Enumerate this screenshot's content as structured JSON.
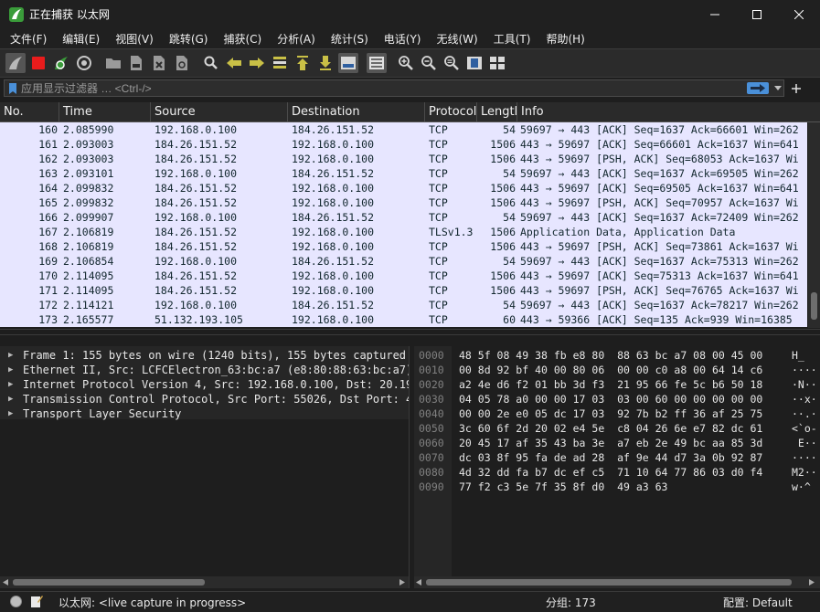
{
  "window": {
    "title": "正在捕获 以太网",
    "minimize_icon": "minimize-icon",
    "maximize_icon": "maximize-icon",
    "close_icon": "close-icon"
  },
  "menu": [
    "文件(F)",
    "编辑(E)",
    "视图(V)",
    "跳转(G)",
    "捕获(C)",
    "分析(A)",
    "统计(S)",
    "电话(Y)",
    "无线(W)",
    "工具(T)",
    "帮助(H)"
  ],
  "filter": {
    "placeholder": "应用显示过滤器 … <Ctrl-/>"
  },
  "packet_list": {
    "columns": [
      "No.",
      "Time",
      "Source",
      "Destination",
      "Protocol",
      "Length",
      "Info"
    ],
    "rows": [
      {
        "no": "160",
        "time": "2.085990",
        "src": "192.168.0.100",
        "dst": "184.26.151.52",
        "proto": "TCP",
        "len": "54",
        "info": "59697 → 443 [ACK] Seq=1637 Ack=66601 Win=262"
      },
      {
        "no": "161",
        "time": "2.093003",
        "src": "184.26.151.52",
        "dst": "192.168.0.100",
        "proto": "TCP",
        "len": "1506",
        "info": "443 → 59697 [ACK] Seq=66601 Ack=1637 Win=641"
      },
      {
        "no": "162",
        "time": "2.093003",
        "src": "184.26.151.52",
        "dst": "192.168.0.100",
        "proto": "TCP",
        "len": "1506",
        "info": "443 → 59697 [PSH, ACK] Seq=68053 Ack=1637 Wi"
      },
      {
        "no": "163",
        "time": "2.093101",
        "src": "192.168.0.100",
        "dst": "184.26.151.52",
        "proto": "TCP",
        "len": "54",
        "info": "59697 → 443 [ACK] Seq=1637 Ack=69505 Win=262"
      },
      {
        "no": "164",
        "time": "2.099832",
        "src": "184.26.151.52",
        "dst": "192.168.0.100",
        "proto": "TCP",
        "len": "1506",
        "info": "443 → 59697 [ACK] Seq=69505 Ack=1637 Win=641"
      },
      {
        "no": "165",
        "time": "2.099832",
        "src": "184.26.151.52",
        "dst": "192.168.0.100",
        "proto": "TCP",
        "len": "1506",
        "info": "443 → 59697 [PSH, ACK] Seq=70957 Ack=1637 Wi"
      },
      {
        "no": "166",
        "time": "2.099907",
        "src": "192.168.0.100",
        "dst": "184.26.151.52",
        "proto": "TCP",
        "len": "54",
        "info": "59697 → 443 [ACK] Seq=1637 Ack=72409 Win=262"
      },
      {
        "no": "167",
        "time": "2.106819",
        "src": "184.26.151.52",
        "dst": "192.168.0.100",
        "proto": "TLSv1.3",
        "len": "1506",
        "info": "Application Data, Application Data"
      },
      {
        "no": "168",
        "time": "2.106819",
        "src": "184.26.151.52",
        "dst": "192.168.0.100",
        "proto": "TCP",
        "len": "1506",
        "info": "443 → 59697 [PSH, ACK] Seq=73861 Ack=1637 Wi"
      },
      {
        "no": "169",
        "time": "2.106854",
        "src": "192.168.0.100",
        "dst": "184.26.151.52",
        "proto": "TCP",
        "len": "54",
        "info": "59697 → 443 [ACK] Seq=1637 Ack=75313 Win=262"
      },
      {
        "no": "170",
        "time": "2.114095",
        "src": "184.26.151.52",
        "dst": "192.168.0.100",
        "proto": "TCP",
        "len": "1506",
        "info": "443 → 59697 [ACK] Seq=75313 Ack=1637 Win=641"
      },
      {
        "no": "171",
        "time": "2.114095",
        "src": "184.26.151.52",
        "dst": "192.168.0.100",
        "proto": "TCP",
        "len": "1506",
        "info": "443 → 59697 [PSH, ACK] Seq=76765 Ack=1637 Wi"
      },
      {
        "no": "172",
        "time": "2.114121",
        "src": "192.168.0.100",
        "dst": "184.26.151.52",
        "proto": "TCP",
        "len": "54",
        "info": "59697 → 443 [ACK] Seq=1637 Ack=78217 Win=262"
      },
      {
        "no": "173",
        "time": "2.165577",
        "src": "51.132.193.105",
        "dst": "192.168.0.100",
        "proto": "TCP",
        "len": "60",
        "info": "443 → 59366 [ACK] Seq=135 Ack=939 Win=16385"
      }
    ]
  },
  "details": [
    "Frame 1: 155 bytes on wire (1240 bits), 155 bytes captured",
    "Ethernet II, Src: LCFCElectron_63:bc:a7 (e8:80:88:63:bc:a7)",
    "Internet Protocol Version 4, Src: 192.168.0.100, Dst: 20.19",
    "Transmission Control Protocol, Src Port: 55026, Dst Port: 4",
    "Transport Layer Security"
  ],
  "bytes": [
    {
      "off": "0000",
      "hex": "48 5f 08 49 38 fb e8 80  88 63 bc a7 08 00 45 00",
      "ascii": "H_"
    },
    {
      "off": "0010",
      "hex": "00 8d 92 bf 40 00 80 06  00 00 c0 a8 00 64 14 c6",
      "ascii": "····"
    },
    {
      "off": "0020",
      "hex": "a2 4e d6 f2 01 bb 3d f3  21 95 66 fe 5c b6 50 18",
      "ascii": "·N··"
    },
    {
      "off": "0030",
      "hex": "04 05 78 a0 00 00 17 03  03 00 60 00 00 00 00 00",
      "ascii": "··x·"
    },
    {
      "off": "0040",
      "hex": "00 00 2e e0 05 dc 17 03  92 7b b2 ff 36 af 25 75",
      "ascii": "··.·"
    },
    {
      "off": "0050",
      "hex": "3c 60 6f 2d 20 02 e4 5e  c8 04 26 6e e7 82 dc 61",
      "ascii": "<`o-"
    },
    {
      "off": "0060",
      "hex": "20 45 17 af 35 43 ba 3e  a7 eb 2e 49 bc aa 85 3d",
      "ascii": " E··"
    },
    {
      "off": "0070",
      "hex": "dc 03 8f 95 fa de ad 28  af 9e 44 d7 3a 0b 92 87",
      "ascii": "····"
    },
    {
      "off": "0080",
      "hex": "4d 32 dd fa b7 dc ef c5  71 10 64 77 86 03 d0 f4",
      "ascii": "M2··"
    },
    {
      "off": "0090",
      "hex": "77 f2 c3 5e 7f 35 8f d0  49 a3 63",
      "ascii": "w·^"
    }
  ],
  "status": {
    "interface": "以太网: <live capture in progress>",
    "packets": "分组: 173",
    "profile": "配置: Default"
  },
  "colors": {
    "row_bg": "#e7e6ff",
    "row_fg": "#12272e",
    "stop_red": "#e81c1c",
    "shark_green": "#3a9c3a",
    "filter_arrow": "#4a90d9"
  }
}
